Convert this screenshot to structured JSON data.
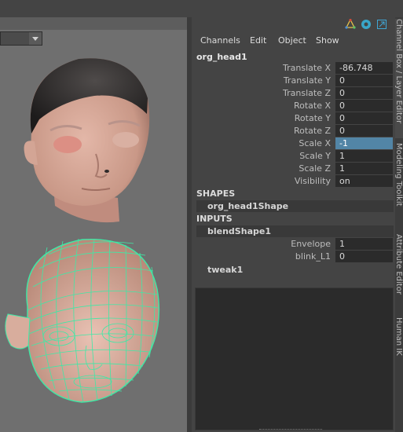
{
  "viewport": {
    "panel_menu_value": ""
  },
  "channel_box": {
    "toolbar_icons": [
      "channel-box-icon",
      "attribute-icon",
      "undock-icon"
    ],
    "menus": [
      "Channels",
      "Edit",
      "Object",
      "Show"
    ],
    "object_name": "org_head1",
    "attributes": [
      {
        "label": "Translate X",
        "value": "-86.748",
        "selected": false
      },
      {
        "label": "Translate Y",
        "value": "0",
        "selected": false
      },
      {
        "label": "Translate Z",
        "value": "0",
        "selected": false
      },
      {
        "label": "Rotate X",
        "value": "0",
        "selected": false
      },
      {
        "label": "Rotate Y",
        "value": "0",
        "selected": false
      },
      {
        "label": "Rotate Z",
        "value": "0",
        "selected": false
      },
      {
        "label": "Scale X",
        "value": "-1",
        "selected": true
      },
      {
        "label": "Scale Y",
        "value": "1",
        "selected": false
      },
      {
        "label": "Scale Z",
        "value": "1",
        "selected": false
      },
      {
        "label": "Visibility",
        "value": "on",
        "selected": false
      }
    ],
    "shapes_header": "SHAPES",
    "shape_node": "org_head1Shape",
    "inputs_header": "INPUTS",
    "input_node": "blendShape1",
    "input_attributes": [
      {
        "label": "Envelope",
        "value": "1"
      },
      {
        "label": "blink_L1",
        "value": "0"
      }
    ],
    "tweak_node": "tweak1"
  },
  "side_tabs": [
    "Channel Box / Layer Editor",
    "Modeling Toolkit",
    "Attribute Editor",
    "Human IK"
  ]
}
